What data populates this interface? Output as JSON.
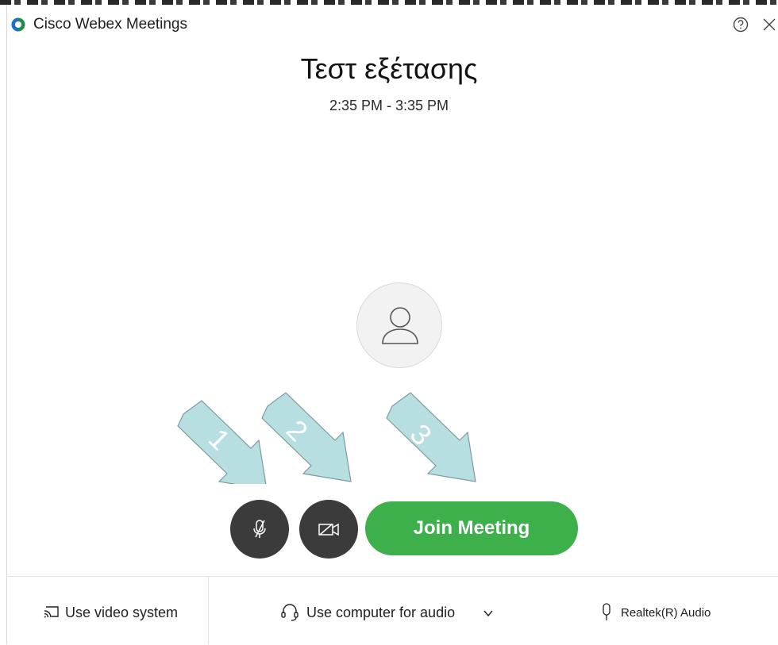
{
  "app": {
    "title": "Cisco Webex Meetings",
    "help_icon": "help-circle-icon",
    "close_icon": "close-icon"
  },
  "meeting": {
    "title": "Τεστ εξέτασης",
    "time": "2:35 PM - 3:35 PM"
  },
  "annotations": [
    {
      "label": "1"
    },
    {
      "label": "2"
    },
    {
      "label": "3"
    }
  ],
  "controls": {
    "mute_icon": "microphone-muted-icon",
    "video_icon": "camera-off-icon",
    "join_label": "Join Meeting"
  },
  "footer": {
    "video_system_label": "Use video system",
    "audio_label": "Use computer for audio",
    "mic_device_label": "Realtek(R) Audio"
  },
  "colors": {
    "join_button": "#3daf4b",
    "round_button": "#3b3b3b",
    "arrow_fill": "#b7dfe2",
    "arrow_stroke": "#7e9aa0"
  }
}
